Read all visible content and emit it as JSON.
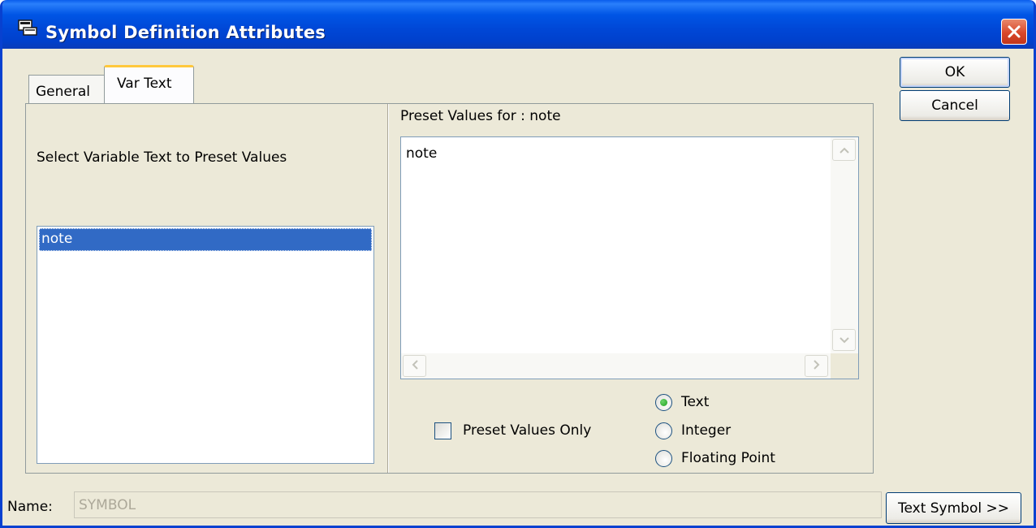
{
  "window": {
    "title": "Symbol Definition Attributes",
    "title_icon": "app-window-icon",
    "close_icon": "close-icon"
  },
  "tabs": [
    {
      "label": "General",
      "active": false
    },
    {
      "label": "Var Text",
      "active": true
    }
  ],
  "left_panel": {
    "instruction": "Select Variable Text to Preset Values",
    "list_items": [
      "note"
    ],
    "selected_item": "note"
  },
  "right_panel": {
    "preset_label": "Preset Values for :  note",
    "preset_value_text": "note",
    "preset_only_label": "Preset Values Only",
    "preset_only_checked": false,
    "type_options": [
      {
        "label": "Text",
        "selected": true
      },
      {
        "label": "Integer",
        "selected": false
      },
      {
        "label": "Floating Point",
        "selected": false
      }
    ]
  },
  "buttons": {
    "ok": "OK",
    "cancel": "Cancel",
    "text_symbol": "Text Symbol >>"
  },
  "name_field": {
    "label": "Name:",
    "value": "SYMBOL"
  },
  "colors": {
    "titlebar": "#0055e5",
    "selection": "#316ac5",
    "dialog_bg": "#ece9d8",
    "tab_highlight": "#ffc83c"
  }
}
